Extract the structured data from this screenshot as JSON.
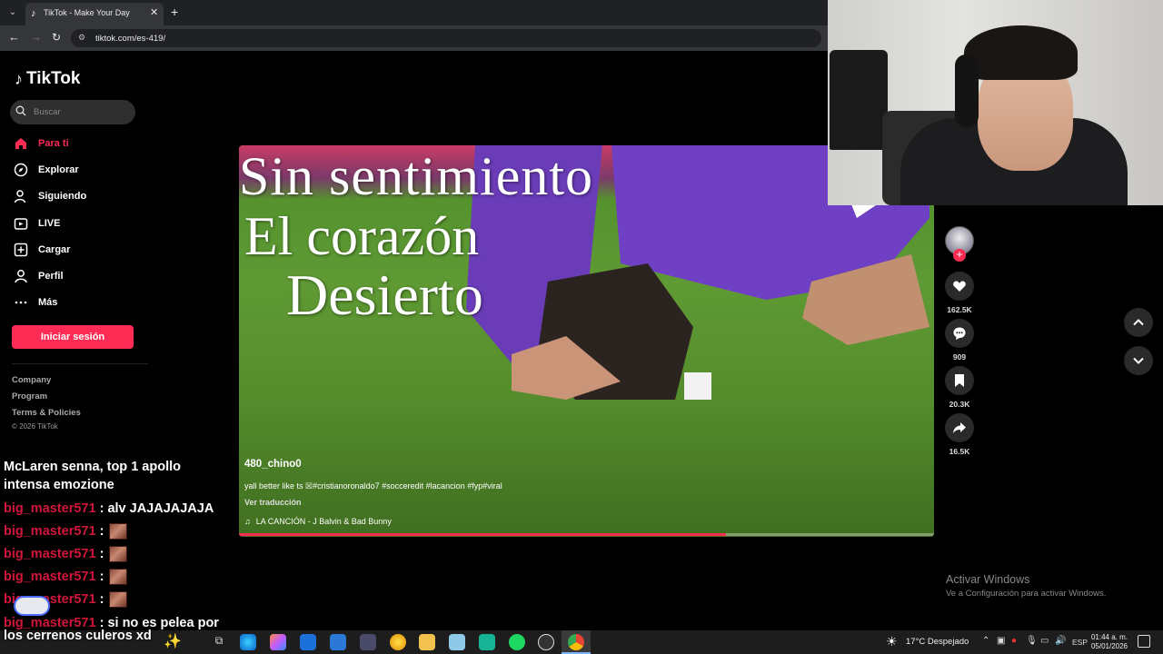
{
  "browser": {
    "tab_title": "TikTok - Make Your Day",
    "url": "tiktok.com/es-419/"
  },
  "sidebar": {
    "logo_text": "TikTok",
    "search_placeholder": "Buscar",
    "nav": [
      {
        "label": "Para ti",
        "icon": "home-icon"
      },
      {
        "label": "Explorar",
        "icon": "compass-icon"
      },
      {
        "label": "Siguiendo",
        "icon": "following-icon"
      },
      {
        "label": "LIVE",
        "icon": "live-icon"
      },
      {
        "label": "Cargar",
        "icon": "upload-icon"
      },
      {
        "label": "Perfil",
        "icon": "profile-icon"
      },
      {
        "label": "Más",
        "icon": "more-icon"
      }
    ],
    "login_label": "Iniciar sesión",
    "footer_links": [
      "Company",
      "Program",
      "Terms & Policies"
    ],
    "copyright": "© 2026 TikTok"
  },
  "chat": {
    "title_line1": "McLaren senna, top 1 apollo",
    "title_line2": "intensa emozione",
    "messages": [
      {
        "user": "big_master571",
        "text": "alv JAJAJAJAJA",
        "emote": false
      },
      {
        "user": "big_master571",
        "text": "",
        "emote": true
      },
      {
        "user": "big_master571",
        "text": "",
        "emote": true
      },
      {
        "user": "big_master571",
        "text": "",
        "emote": true
      },
      {
        "user": "big_master571",
        "text": "",
        "emote": true
      },
      {
        "user": "big_master571",
        "text": "si no es pelea por",
        "emote": false
      }
    ],
    "overflow_line": "los cerrenos culeros xd"
  },
  "video": {
    "lyrics": [
      "Sin sentimiento",
      "El corazón",
      "Desierto"
    ],
    "author": "480_chino0",
    "caption": "yall better like ts ☒#cristianoronaldo7 #socceredit #lacancion #fyp#viral",
    "translate": "Ver traducción",
    "music": "LA CANCIÓN - J Balvin & Bad Bunny",
    "progress": 0.7
  },
  "actions": {
    "likes": "162.5K",
    "comments": "909",
    "saves": "20.3K",
    "shares": "16.5K"
  },
  "activate_windows": {
    "title": "Activar Windows",
    "subtitle": "Ve a Configuración para activar Windows."
  },
  "taskbar": {
    "weather": "17°C  Despejado",
    "lang": "ESP",
    "time": "01:44 a. m.",
    "date": "05/01/2026"
  },
  "colors": {
    "accent": "#fe2c55",
    "chat_user": "#d0163a"
  }
}
